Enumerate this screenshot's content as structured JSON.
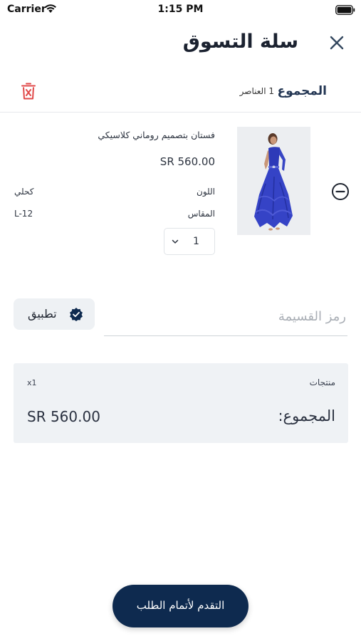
{
  "status_bar": {
    "carrier": "Carrier",
    "time": "1:15 PM"
  },
  "nav": {
    "title": "سلة التسوق",
    "close_icon": "close-icon"
  },
  "cart_summary": {
    "label": "المجموع",
    "count": "1 العناصر",
    "delete_icon": "trash-icon",
    "delete_color": "#e04848"
  },
  "items": [
    {
      "name": "فستان بتصميم روماني كلاسيكي",
      "price": "SR 560.00",
      "color_label": "اللون",
      "color_value": "كحلي",
      "size_label": "المقاس",
      "size_value": "L-12",
      "quantity": "1",
      "remove_icon": "minus-circle-icon",
      "image": "dress-photo"
    }
  ],
  "coupon": {
    "placeholder": "رمز القسيمة",
    "value": "",
    "apply_label": "تطبيق",
    "apply_icon": "verified-badge-icon"
  },
  "totals": {
    "products_label": "منتجات",
    "products_qty": "x1",
    "total_label": "المجموع:",
    "total_value": "SR 560.00"
  },
  "checkout": {
    "label": "التقدم لأتمام الطلب"
  },
  "colors": {
    "primary": "#0e2a4f",
    "accent_text": "#233653",
    "danger": "#e04848",
    "panel_bg": "#eff2f5"
  }
}
